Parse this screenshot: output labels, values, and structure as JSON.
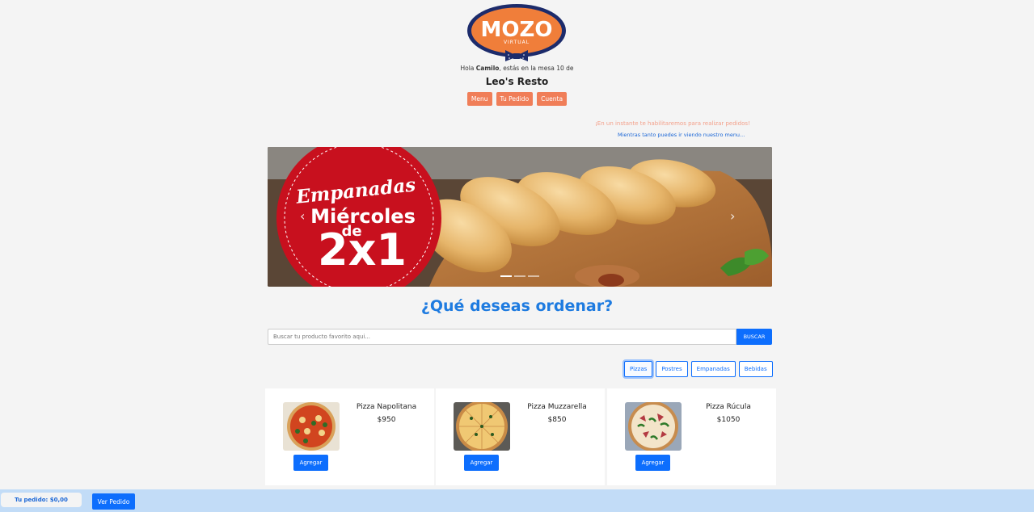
{
  "logo": {
    "text": "MOZO",
    "subtext": "VIRTUAL"
  },
  "greeting": {
    "prefix": "Hola ",
    "user": "Camilo",
    "suffix": ", estás en la mesa 10 de"
  },
  "restaurant_name": "Leo's Resto",
  "nav": [
    {
      "label": "Menu"
    },
    {
      "label": "Tu Pedido"
    },
    {
      "label": "Cuenta"
    }
  ],
  "notice": {
    "line1": "¡En un instante te habilitaremos para realizar pedidos!",
    "line2": "Mientras tanto puedes ir viendo nuestro menu..."
  },
  "carousel": {
    "banner_line1": "Empanadas",
    "banner_line2": "Miércoles",
    "banner_line3": "de",
    "banner_line4": "2x1",
    "prev_icon": "‹",
    "next_icon": "›",
    "slides": 3,
    "active_slide": 1
  },
  "question": "¿Qué deseas ordenar?",
  "search": {
    "placeholder": "Buscar tu producto favorito aqui...",
    "button": "BUSCAR"
  },
  "categories": [
    {
      "label": "Pizzas",
      "active": true
    },
    {
      "label": "Postres",
      "active": false
    },
    {
      "label": "Empanadas",
      "active": false
    },
    {
      "label": "Bebidas",
      "active": false
    }
  ],
  "products": [
    {
      "name": "Pizza Napolitana",
      "price": "$950",
      "button": "Agregar"
    },
    {
      "name": "Pizza Muzzarella",
      "price": "$850",
      "button": "Agregar"
    },
    {
      "name": "Pizza Rúcula",
      "price": "$1050",
      "button": "Agregar"
    }
  ],
  "footer": {
    "total": "Tu pedido: $0,00",
    "button": "Ver Pedido"
  },
  "colors": {
    "brand_orange": "#f07e58",
    "primary_blue": "#0d6efd",
    "footer_bg": "#c2dcf7",
    "promo_red": "#c8101e"
  }
}
